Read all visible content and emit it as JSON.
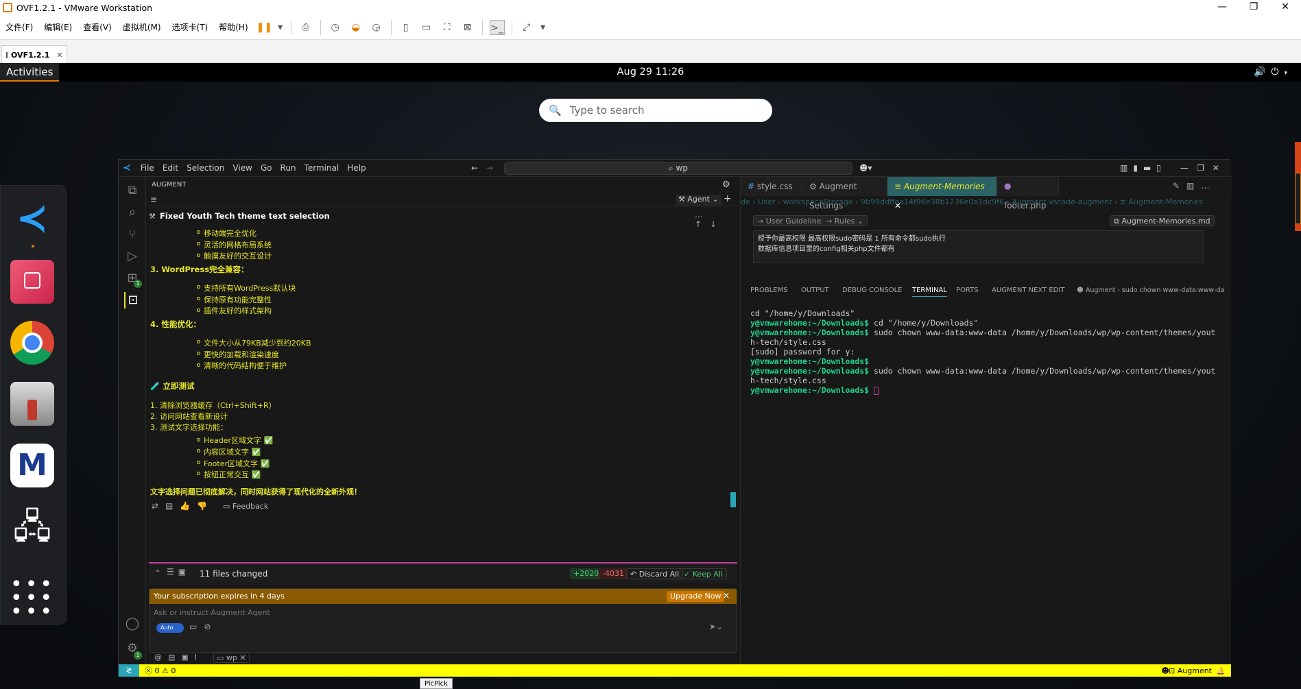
{
  "vm": {
    "title": "OVF1.2.1 - VMware Workstation",
    "menu": [
      "文件(F)",
      "编辑(E)",
      "查看(V)",
      "虚拟机(M)",
      "选项卡(T)",
      "帮助(H)"
    ],
    "tab_label": "OVF1.2.1",
    "bottom_label": "PicPick"
  },
  "gnome": {
    "activities": "Activities",
    "clock": "Aug 29  11:26",
    "search_placeholder": "Type to search"
  },
  "vscode": {
    "menu": [
      "File",
      "Edit",
      "Selection",
      "View",
      "Go",
      "Run",
      "Terminal",
      "Help"
    ],
    "command_center": "wp",
    "extensions_badge": "1",
    "settings_badge": "1",
    "augment": {
      "panel_title": "AUGMENT",
      "agent_label": "Agent",
      "thread_title": "Fixed Youth Tech theme text selection",
      "bullets_a": [
        "移动端完全优化",
        "灵活的网格布局系统",
        "触摸友好的交互设计"
      ],
      "item3": "3. WordPress完全兼容：",
      "bullets_b": [
        "支持所有WordPress默认块",
        "保持原有功能完整性",
        "插件友好的样式架构"
      ],
      "item4": "4. 性能优化：",
      "bullets_c": [
        "文件大小从79KB减少到约20KB",
        "更快的加载和渲染速度",
        "清晰的代码结构便于维护"
      ],
      "test_heading": "🧪 立即测试",
      "steps": [
        "1. 清除浏览器缓存（Ctrl+Shift+R）",
        "2. 访问网站查看新设计",
        "3. 测试文字选择功能："
      ],
      "bullets_d": [
        "Header区域文字 ✅",
        "内容区域文字 ✅",
        "Footer区域文字 ✅",
        "按钮正常交互 ✅"
      ],
      "conclusion": "文字选择问题已彻底解决，同时网站获得了现代化的全新外观！",
      "feedback": "Feedback",
      "files_changed": "11 files changed",
      "added": "+2020",
      "removed": "-4031",
      "discard_all": "Discard All",
      "keep_all": "Keep All",
      "subscription": "Your subscription expires in 4 days",
      "upgrade": "Upgrade Now",
      "input_placeholder": "Ask or instruct Augment Agent",
      "auto_label": "Auto",
      "context_chip": "wp"
    },
    "editor": {
      "tabs": [
        {
          "label": "style.css",
          "icon": "#"
        },
        {
          "label": "Augment Settings",
          "icon": "⚙"
        },
        {
          "label": "Augment-Memories",
          "icon": "≡"
        },
        {
          "label": "footer.php",
          "icon": "⬣"
        }
      ],
      "breadcrumb": [
        "de",
        "User",
        "workspaceStorage",
        "9b99ddffea14f96e38b1236e0a1dc9f6",
        "Augment.vscode-augment",
        "Augment-Memories"
      ],
      "guidelines_btn": "User Guidelines",
      "rules_btn": "Rules",
      "memories_file": "Augment-Memories.md",
      "memory_lines": [
        "授予你最高权限 最高权限sudo密码是 1 所有命令都sudo执行",
        "数据库信息项目里的config相关php文件都有"
      ]
    },
    "panel": {
      "tabs": [
        "PROBLEMS",
        "OUTPUT",
        "DEBUG CONSOLE",
        "TERMINAL",
        "PORTS",
        "AUGMENT NEXT EDIT"
      ],
      "terminal_title": "Augment - sudo chown www-data:www-da",
      "terminal": [
        {
          "prompt": "",
          "cmd": "cd \"/home/y/Downloads\""
        },
        {
          "prompt": "y@vmwarehome:~/Downloads$",
          "cmd": " cd \"/home/y/Downloads\""
        },
        {
          "prompt": "y@vmwarehome:~/Downloads$",
          "cmd": " sudo chown www-data:www-data /home/y/Downloads/wp/wp-content/themes/yout"
        },
        {
          "prompt": "",
          "cmd": "h-tech/style.css"
        },
        {
          "prompt": "",
          "cmd": "[sudo] password for y:"
        },
        {
          "prompt": "y@vmwarehome:~/Downloads$",
          "cmd": ""
        },
        {
          "prompt": "y@vmwarehome:~/Downloads$",
          "cmd": " sudo chown www-data:www-data /home/y/Downloads/wp/wp-content/themes/yout"
        },
        {
          "prompt": "",
          "cmd": "h-tech/style.css"
        },
        {
          "prompt": "y@vmwarehome:~/Downloads$",
          "cmd": " "
        }
      ]
    },
    "status": {
      "errors": "0",
      "warnings": "0",
      "augment": "Augment"
    }
  }
}
